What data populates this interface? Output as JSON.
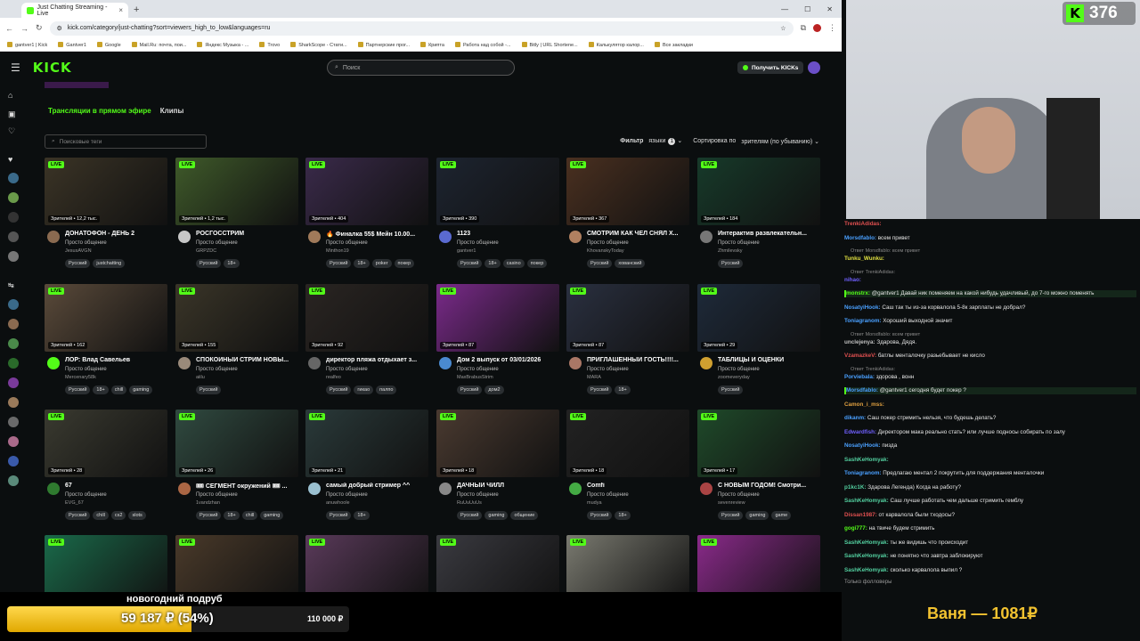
{
  "browser": {
    "tab_title": "Just Chatting Streaming - Live",
    "new_tab": "+",
    "url": "kick.com/category/just-chatting?sort=viewers_high_to_low&languages=ru",
    "bookmarks": [
      "gantver1 | Kick",
      "Gantver1",
      "Google",
      "Mail.Ru: почта, пои...",
      "Яндекс Музыка - ...",
      "Trovo",
      "SharkScope - Стати...",
      "Партнерские прог...",
      "Крипта",
      "Работа над собой -...",
      "Bitly | URL Shortene...",
      "Калькулятор калор...",
      "Все закладки"
    ]
  },
  "header": {
    "logo": "KICK",
    "search_placeholder": "Поиск",
    "get_kicks": "Получить KICKs"
  },
  "content": {
    "tab_live": "Трансляции в прямом эфире",
    "tab_clips": "Клипы",
    "tag_search_placeholder": "Поисковые теги",
    "filter_label": "Фильтр",
    "languages_label": "языки",
    "languages_count": "1",
    "sort_label": "Сортировка по",
    "sort_value": "зрителям (по убыванию)"
  },
  "live_badge": "LIVE",
  "cards": [
    {
      "title": "ДОНАТОФОН - ДЕНЬ 2",
      "category": "Просто общение",
      "channel": "JesusAVGN",
      "viewers": "Зрителей • 12,2 тыс.",
      "tags": [
        "Русский",
        "justchatting"
      ],
      "color": "#3b3426",
      "avatar": "#8a6a50"
    },
    {
      "title": "РОСГОССТРИМ",
      "category": "Просто общение",
      "channel": "GRPZDC",
      "viewers": "Зрителей • 1,2 тыс.",
      "tags": [
        "Русский",
        "18+"
      ],
      "color": "#3f5a2a",
      "avatar": "#c7c7c7"
    },
    {
      "title": "🔥 Финалка 55$ Мейн 10.00...",
      "category": "Просто общение",
      "channel": "Minthon19",
      "viewers": "Зрителей • 404",
      "tags": [
        "Русский",
        "18+",
        "poker",
        "покер"
      ],
      "color": "#3a2a4a",
      "avatar": "#a07a5a"
    },
    {
      "title": "1123",
      "category": "Просто общение",
      "channel": "gantver1",
      "viewers": "Зрителей • 390",
      "tags": [
        "Русский",
        "18+",
        "casino",
        "покер"
      ],
      "color": "#1d2430",
      "avatar": "#5a6ad0"
    },
    {
      "title": "СМОТРИМ КАК ЧЕЛ СНЯЛ Х...",
      "category": "Просто общение",
      "channel": "KhovanskyToday",
      "viewers": "Зрителей • 367",
      "tags": [
        "Русский",
        "хованский"
      ],
      "color": "#4a3020",
      "avatar": "#b08060"
    },
    {
      "title": "Интерактив развлекательн...",
      "category": "Просто общение",
      "channel": "Zhmilevsky",
      "viewers": "Зрителей • 184",
      "tags": [
        "Русский"
      ],
      "color": "#173a2a",
      "avatar": "#777777"
    },
    {
      "title": "ЛОР: Влад Савельев",
      "category": "Просто общение",
      "channel": "Mercenary58k",
      "viewers": "Зрителей • 162",
      "tags": [
        "Русский",
        "18+",
        "chill",
        "gaming"
      ],
      "color": "#5a4a3a",
      "avatar": "#53fc18"
    },
    {
      "title": "СПОКОЙНЫЙ СТРИМ НОВЫ...",
      "category": "Просто общение",
      "channel": "aiilu",
      "viewers": "Зрителей • 155",
      "tags": [
        "Русский"
      ],
      "color": "#3a3528",
      "avatar": "#9a8a7a"
    },
    {
      "title": "директор пляжа отдыхает з...",
      "category": "Просто общение",
      "channel": "realfeo",
      "viewers": "Зрителей • 92",
      "tags": [
        "Русский",
        "гикао",
        "палпо"
      ],
      "color": "#2a2522",
      "avatar": "#666666"
    },
    {
      "title": "Дом 2 выпуск от 03/01/2026",
      "category": "Просто общение",
      "channel": "MaxBrabusStrim",
      "viewers": "Зрителей • 87",
      "tags": [
        "Русский",
        "дом2"
      ],
      "color": "#7a2a8a",
      "avatar": "#4a8ad0"
    },
    {
      "title": "ПРИГЛАШЕННЫЙ ГОСТЬ!!!!...",
      "category": "Просто общение",
      "channel": "MARA",
      "viewers": "Зрителей • 87",
      "tags": [
        "Русский",
        "18+"
      ],
      "color": "#2a3040",
      "avatar": "#aa7766"
    },
    {
      "title": "ТАБЛИЦЫ И ОЦЕНКИ",
      "category": "Просто общение",
      "channel": "zoomeveryday",
      "viewers": "Зрителей • 29",
      "tags": [
        "Русский"
      ],
      "color": "#1e2a3a",
      "avatar": "#d0a030"
    },
    {
      "title": "67",
      "category": "Просто общение",
      "channel": "EVG_67",
      "viewers": "Зрителей • 28",
      "tags": [
        "Русский",
        "chill",
        "cs2",
        "slots"
      ],
      "color": "#3a3a30",
      "avatar": "#2f7a2f"
    },
    {
      "title": "🎟 СЕГМЕНТ окружений 🎟 ...",
      "category": "Просто общение",
      "channel": "1vandzhan",
      "viewers": "Зрителей • 26",
      "tags": [
        "Русский",
        "18+",
        "chill",
        "gaming"
      ],
      "color": "#304a40",
      "avatar": "#aa6644"
    },
    {
      "title": "самый добрый стример ^^",
      "category": "Просто общение",
      "channel": "anuwhoole",
      "viewers": "Зрителей • 21",
      "tags": [
        "Русский",
        "18+"
      ],
      "color": "#2a3a3a",
      "avatar": "#9ac0d0"
    },
    {
      "title": "ДАЧНЫЙ ЧИЛЛ",
      "category": "Просто общение",
      "channel": "RuUuUuUs",
      "viewers": "Зрителей • 18",
      "tags": [
        "Русский",
        "gaming",
        "общение"
      ],
      "color": "#4a3a30",
      "avatar": "#888888"
    },
    {
      "title": "Comfi",
      "category": "Просто общение",
      "channel": "mudya",
      "viewers": "Зрителей • 18",
      "tags": [
        "Русский",
        "18+"
      ],
      "color": "#222222",
      "avatar": "#44aa44"
    },
    {
      "title": "С НОВЫМ ГОДОМ! Смотри...",
      "category": "Просто общение",
      "channel": "sevenreview",
      "viewers": "Зрителей • 17",
      "tags": [
        "Русский",
        "gaming",
        "game"
      ],
      "color": "#1f4a2a",
      "avatar": "#aa4444"
    },
    {
      "title": "",
      "category": "",
      "channel": "",
      "viewers": "",
      "tags": [],
      "color": "#1a6a4a",
      "avatar": ""
    },
    {
      "title": "",
      "category": "",
      "channel": "",
      "viewers": "",
      "tags": [],
      "color": "#4a3a2a",
      "avatar": ""
    },
    {
      "title": "",
      "category": "",
      "channel": "",
      "viewers": "",
      "tags": [],
      "color": "#5a3a5a",
      "avatar": ""
    },
    {
      "title": "",
      "category": "",
      "channel": "",
      "viewers": "",
      "tags": [],
      "color": "#3a3a40",
      "avatar": ""
    },
    {
      "title": "",
      "category": "",
      "channel": "",
      "viewers": "",
      "tags": [],
      "color": "#7a7a70",
      "avatar": ""
    },
    {
      "title": "",
      "category": "",
      "channel": "",
      "viewers": "",
      "tags": [],
      "color": "#8a2a8a",
      "avatar": ""
    }
  ],
  "stream_overlay": {
    "viewer_count": "376",
    "goal_title": "новогодний подруб",
    "goal_current": "59 187 ₽ (54%)",
    "goal_percent": 54,
    "goal_target": "110 000 ₽",
    "donor_line": "Ваня — 1081₽"
  },
  "chat": {
    "messages": [
      {
        "user": "TrenkiAdidas:",
        "text": "",
        "color": "#e05050",
        "reply": ""
      },
      {
        "user": "Morsdfablo:",
        "text": "всем привет",
        "color": "#4aa0ff",
        "reply": ""
      },
      {
        "user": "Tunku_Wunku:",
        "text": "",
        "color": "#e0e040",
        "reply": "Ответ Morsdfablo: всем привет"
      },
      {
        "user": "nihao:",
        "text": "",
        "color": "#7060ff",
        "reply": "Ответ TrenkiAdidas:"
      },
      {
        "user": "monstrx:",
        "text": "@gantver1 Давай ник поменяем на какой нибудь удачливый, до 7-го можно поменять",
        "color": "#53fc18",
        "reply": ""
      },
      {
        "user": "NosatyiHook:",
        "text": "Саш так ты из-за корвалола 5-8к зарплаты не добрал?",
        "color": "#4aa0ff",
        "reply": ""
      },
      {
        "user": "Toniagranom:",
        "text": "Хороший выходной значит",
        "color": "#4aa0ff",
        "reply": ""
      },
      {
        "user": "unclejenya:",
        "text": "Здарова, Дядя.",
        "color": "#c0c0c0",
        "reply": "Ответ Morsdfablo: всем привет"
      },
      {
        "user": "VzamazkeV:",
        "text": "батлы менталочку разьебывает не кисло",
        "color": "#e05050",
        "reply": ""
      },
      {
        "user": "Porviebala:",
        "text": "здорова , вонн",
        "color": "#4aa0ff",
        "reply": "Ответ TrenkiAdidas:"
      },
      {
        "user": "Morsdfablo:",
        "text": "@gantver1 сегодня будет покер ?",
        "color": "#4aa0ff",
        "reply": ""
      },
      {
        "user": "Camon_i_mss:",
        "text": "",
        "color": "#e0a040",
        "reply": ""
      },
      {
        "user": "dikanm:",
        "text": "Саш покер стримить нельзя, что будешь делать?",
        "color": "#4aa0ff",
        "reply": ""
      },
      {
        "user": "Edwardfish:",
        "text": "Директором мака реально стать? или лучше подносы собирать по залу",
        "color": "#7060ff",
        "reply": ""
      },
      {
        "user": "NosatyiHook:",
        "text": "пизда",
        "color": "#4aa0ff",
        "reply": ""
      },
      {
        "user": "SashKeHomyak:",
        "text": "",
        "color": "#53d0a0",
        "reply": ""
      },
      {
        "user": "Toniagranom:",
        "text": "Предлагаю ментал 2 покрутить для поддержания менталочки",
        "color": "#4aa0ff",
        "reply": ""
      },
      {
        "user": "p1kc1K:",
        "text": "Здарова Легенда) Когда на работу?",
        "color": "#53d0a0",
        "reply": ""
      },
      {
        "user": "SashKeHomyak:",
        "text": "Саш лучше работать чем дальше стримить гемблу",
        "color": "#53d0a0",
        "reply": ""
      },
      {
        "user": "Dissan1987:",
        "text": "от карвалола были тходосы?",
        "color": "#e05050",
        "reply": ""
      },
      {
        "user": "gogi777:",
        "text": "на твиче будем стримить",
        "color": "#53fc18",
        "reply": ""
      },
      {
        "user": "SashKeHomyak:",
        "text": "ты же видишь что происходит",
        "color": "#53d0a0",
        "reply": ""
      },
      {
        "user": "SashKeHomyak:",
        "text": "не понятно что завтра заблокируют",
        "color": "#53d0a0",
        "reply": ""
      },
      {
        "user": "SashKeHomyak:",
        "text": "сколько карвалола выпил ?",
        "color": "#53d0a0",
        "reply": ""
      }
    ],
    "footer": "Только фолловеры"
  }
}
